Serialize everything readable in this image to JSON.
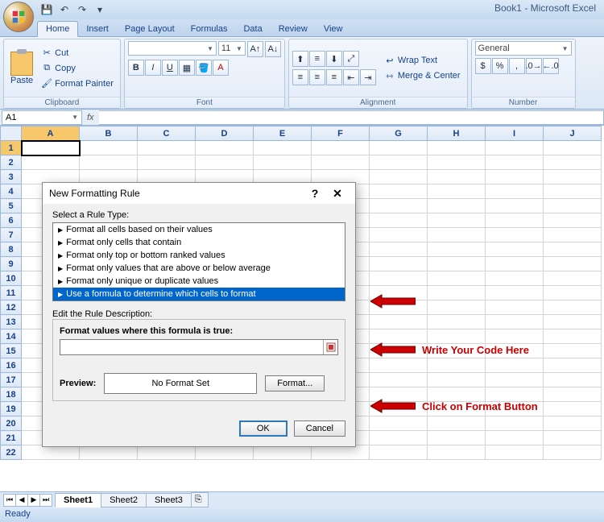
{
  "title": "Book1 - Microsoft Excel",
  "tabs": [
    "Home",
    "Insert",
    "Page Layout",
    "Formulas",
    "Data",
    "Review",
    "View"
  ],
  "activeTab": "Home",
  "clipboard": {
    "label": "Clipboard",
    "paste": "Paste",
    "cut": "Cut",
    "copy": "Copy",
    "painter": "Format Painter"
  },
  "font": {
    "label": "Font",
    "name": "",
    "size": "11"
  },
  "alignment": {
    "label": "Alignment",
    "wrap": "Wrap Text",
    "merge": "Merge & Center"
  },
  "number": {
    "label": "Number",
    "format": "General"
  },
  "namebox": "A1",
  "columns": [
    "A",
    "B",
    "C",
    "D",
    "E",
    "F",
    "G",
    "H",
    "I",
    "J"
  ],
  "rows": [
    "1",
    "2",
    "3",
    "4",
    "5",
    "6",
    "7",
    "8",
    "9",
    "10",
    "11",
    "12",
    "13",
    "14",
    "15",
    "16",
    "17",
    "18",
    "19",
    "20",
    "21",
    "22"
  ],
  "sheets": [
    "Sheet1",
    "Sheet2",
    "Sheet3"
  ],
  "status": "Ready",
  "dialog": {
    "title": "New Formatting Rule",
    "ruleTypeLabel": "Select a Rule Type:",
    "rules": [
      "Format all cells based on their values",
      "Format only cells that contain",
      "Format only top or bottom ranked values",
      "Format only values that are above or below average",
      "Format only unique or duplicate values",
      "Use a formula to determine which cells to format"
    ],
    "editLabel": "Edit the Rule Description:",
    "formulaLabel": "Format values where this formula is true:",
    "previewLabel": "Preview:",
    "previewValue": "No Format Set",
    "formatBtn": "Format...",
    "ok": "OK",
    "cancel": "Cancel"
  },
  "annotation1": "Write Your Code Here",
  "annotation2": "Click on Format Button"
}
